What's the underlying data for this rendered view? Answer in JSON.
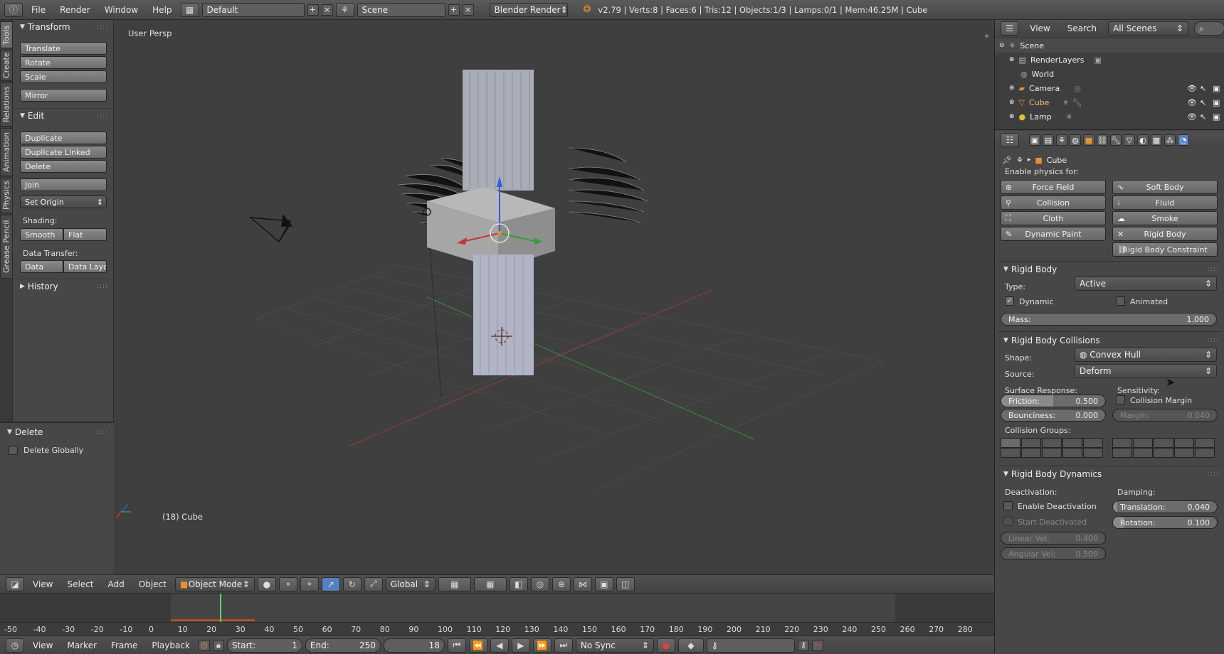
{
  "topbar": {
    "menus": [
      "File",
      "Render",
      "Window",
      "Help"
    ],
    "layout": "Default",
    "scene": "Scene",
    "engine": "Blender Render",
    "stats": "v2.79 | Verts:8 | Faces:6 | Tris:12 | Objects:1/3 | Lamps:0/1 | Mem:46.25M | Cube"
  },
  "lefttabs": [
    "Tools",
    "Create",
    "Relations",
    "Animation",
    "Physics",
    "Grease Pencil"
  ],
  "tools": {
    "transform_title": "Transform",
    "translate": "Translate",
    "rotate": "Rotate",
    "scale": "Scale",
    "mirror": "Mirror",
    "edit_title": "Edit",
    "duplicate": "Duplicate",
    "duplicate_linked": "Duplicate Linked",
    "delete": "Delete",
    "join": "Join",
    "set_origin": "Set Origin",
    "shading_label": "Shading:",
    "smooth": "Smooth",
    "flat": "Flat",
    "data_transfer_label": "Data Transfer:",
    "data": "Data",
    "data_layout": "Data Layo",
    "history_title": "History",
    "delete_op_title": "Delete",
    "delete_globally": "Delete Globally"
  },
  "viewport": {
    "persp_label": "User Persp",
    "object_label": "(18) Cube"
  },
  "vhead": {
    "view": "View",
    "select": "Select",
    "add": "Add",
    "object": "Object",
    "mode": "Object Mode",
    "orientation": "Global"
  },
  "timeline": {
    "ticks": [
      "-50",
      "-40",
      "-30",
      "-20",
      "-10",
      "0",
      "10",
      "20",
      "30",
      "40",
      "50",
      "60",
      "70",
      "80",
      "90",
      "100",
      "110",
      "120",
      "130",
      "140",
      "150",
      "160",
      "170",
      "180",
      "190",
      "200",
      "210",
      "220",
      "230",
      "240",
      "250",
      "260",
      "270",
      "280"
    ]
  },
  "tlhead": {
    "view": "View",
    "marker": "Marker",
    "frame": "Frame",
    "playback": "Playback",
    "start_label": "Start:",
    "start_value": "1",
    "end_label": "End:",
    "end_value": "250",
    "current": "18",
    "sync": "No Sync"
  },
  "outliner": {
    "view": "View",
    "search": "Search",
    "filter": "All Scenes",
    "items": [
      "Scene",
      "RenderLayers",
      "World",
      "Camera",
      "Cube",
      "Lamp"
    ]
  },
  "props": {
    "context": "Cube",
    "enable_label": "Enable physics for:",
    "physics_left": [
      "Force Field",
      "Collision",
      "Cloth",
      "Dynamic Paint"
    ],
    "physics_right": [
      "Soft Body",
      "Fluid",
      "Smoke",
      "Rigid Body",
      "Rigid Body Constraint"
    ],
    "rb_title": "Rigid Body",
    "type_label": "Type:",
    "type_value": "Active",
    "dynamic": "Dynamic",
    "animated": "Animated",
    "mass_label": "Mass:",
    "mass_value": "1.000",
    "rbc_title": "Rigid Body Collisions",
    "shape_label": "Shape:",
    "shape_value": "Convex Hull",
    "source_label": "Source:",
    "source_value": "Deform",
    "surface_label": "Surface Response:",
    "sensitivity_label": "Sensitivity:",
    "friction_label": "Friction:",
    "friction_value": "0.500",
    "bounciness_label": "Bounciness:",
    "bounciness_value": "0.000",
    "collision_margin": "Collision Margin",
    "margin_label": "Margin:",
    "margin_value": "0.040",
    "groups_label": "Collision Groups:",
    "rbd_title": "Rigid Body Dynamics",
    "deactivation_label": "Deactivation:",
    "damping_label": "Damping:",
    "enable_deactivation": "Enable Deactivation",
    "start_deactivated": "Start Deactivated",
    "translation_label": "Translation:",
    "translation_value": "0.040",
    "rotation_label": "Rotation:",
    "rotation_value": "0.100",
    "linear_label": "Linear Vel:",
    "linear_value": "0.400",
    "angular_label": "Angular Vel:",
    "angular_value": "0.500"
  },
  "colors": {
    "accent": "#5680c2",
    "x_axis": "#c53636",
    "y_axis": "#3a9a3a",
    "z_axis": "#3a5ad8"
  }
}
